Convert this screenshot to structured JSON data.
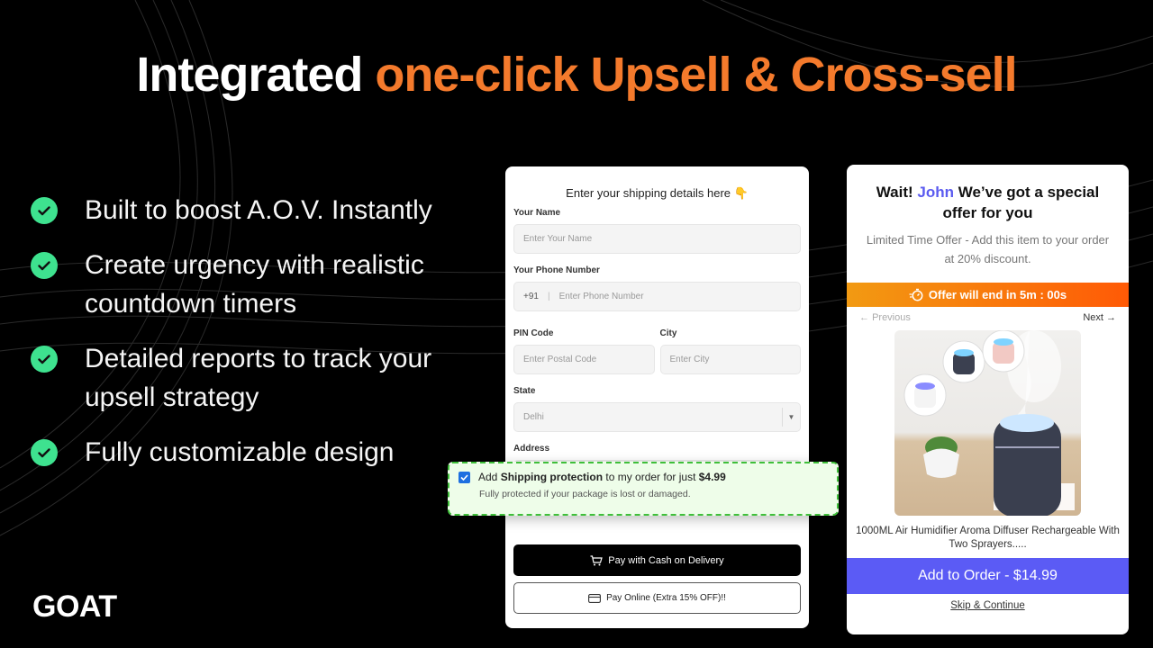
{
  "headline": {
    "part1": "Integrated ",
    "part2": "one-click Upsell & Cross-sell",
    "accent_color": "#f47a2c"
  },
  "features": [
    {
      "icon": "check-circle-icon",
      "text": "Built to boost A.O.V. Instantly"
    },
    {
      "icon": "check-circle-icon",
      "text": "Create urgency with realistic countdown timers"
    },
    {
      "icon": "check-circle-icon",
      "text": "Detailed reports to track your upsell strategy"
    },
    {
      "icon": "check-circle-icon",
      "text": "Fully customizable design"
    }
  ],
  "logo": "GOAT",
  "shipping_form": {
    "title": "Enter your shipping details here 👇",
    "name_label": "Your Name",
    "name_placeholder": "Enter Your Name",
    "phone_label": "Your Phone Number",
    "phone_prefix": "+91",
    "phone_placeholder": "Enter Phone Number",
    "pin_label": "PIN Code",
    "pin_placeholder": "Enter Postal Code",
    "city_label": "City",
    "city_placeholder": "Enter City",
    "state_label": "State",
    "state_value": "Delhi",
    "address_label": "Address",
    "cod_button": "Pay with Cash on Delivery",
    "online_button": "Pay Online (Extra 15% OFF)!!"
  },
  "protection": {
    "checked": true,
    "prefix": "Add ",
    "bold": "Shipping protection",
    "middle": " to my order for just ",
    "price": "$4.99",
    "subtext": "Fully protected if your package is lost or damaged."
  },
  "offer": {
    "title_pre": "Wait! ",
    "name": "John",
    "title_post": " We’ve got a special offer for you",
    "subtitle": "Limited Time Offer - Add this item to your order at 20% discount.",
    "timer_text": "Offer will end in 5m : 00s",
    "prev_label": "Previous",
    "next_label": "Next",
    "product_name": "1000ML Air Humidifier Aroma Diffuser Rechargeable With Two Sprayers.....",
    "add_button": "Add to Order - $14.99",
    "skip_link": "Skip & Continue",
    "button_color": "#5b5bf5"
  }
}
